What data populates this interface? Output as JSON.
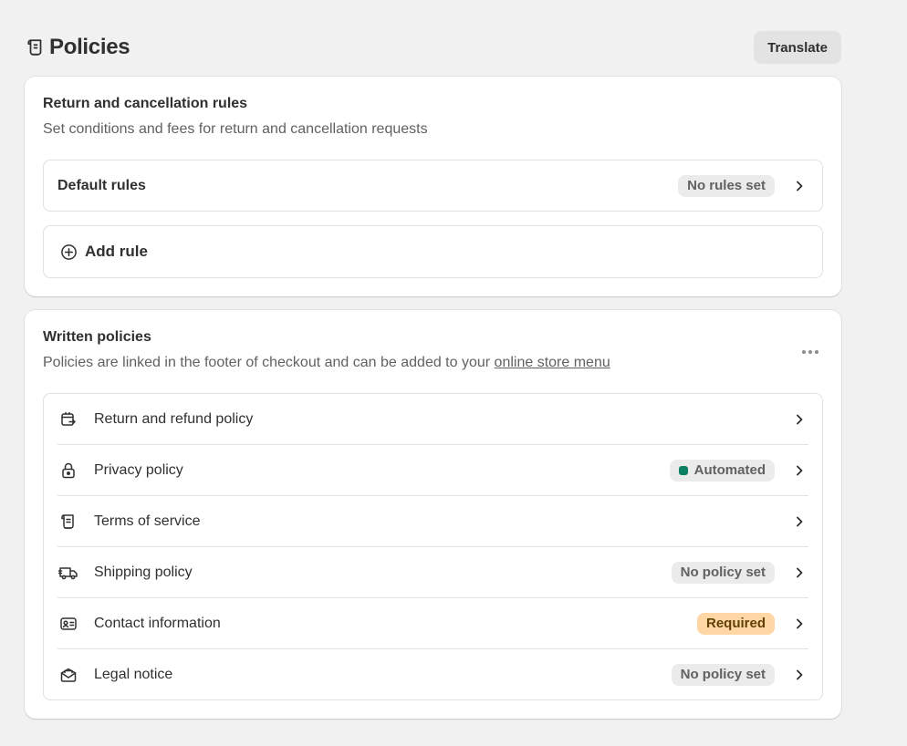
{
  "header": {
    "title": "Policies",
    "title_icon": "policy-scroll-icon",
    "translate_label": "Translate"
  },
  "rules_card": {
    "title": "Return and cancellation rules",
    "subtitle": "Set conditions and fees for return and cancellation requests",
    "default_rules": {
      "label": "Default rules",
      "badge": "No rules set"
    },
    "add_rule": {
      "label": "Add rule",
      "icon": "plus-circle-icon"
    }
  },
  "policies_card": {
    "title": "Written policies",
    "subtitle_prefix": "Policies are linked in the footer of checkout and can be added to your ",
    "subtitle_link": "online store menu",
    "items": [
      {
        "label": "Return and refund policy",
        "icon": "return-icon",
        "badge": ""
      },
      {
        "label": "Privacy policy",
        "icon": "lock-icon",
        "badge": "Automated",
        "badge_style": "success"
      },
      {
        "label": "Terms of service",
        "icon": "scroll-icon",
        "badge": ""
      },
      {
        "label": "Shipping policy",
        "icon": "truck-icon",
        "badge": "No policy set"
      },
      {
        "label": "Contact information",
        "icon": "id-card-icon",
        "badge": "Required",
        "badge_style": "warning"
      },
      {
        "label": "Legal notice",
        "icon": "envelope-icon",
        "badge": "No policy set"
      }
    ]
  },
  "colors": {
    "background": "#f1f1f1",
    "card": "#ffffff",
    "automated_dot": "#0c7e62",
    "required_badge": "#ffd6a4"
  }
}
